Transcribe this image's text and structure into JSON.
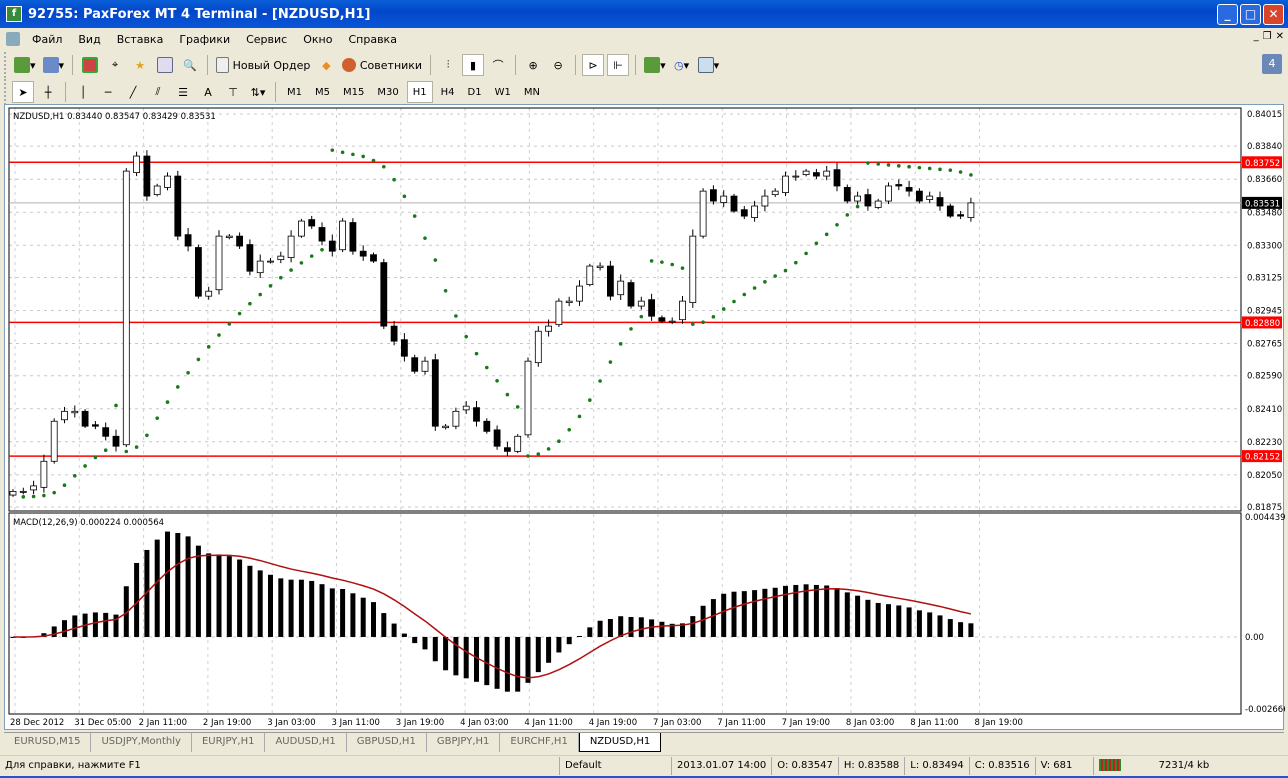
{
  "window": {
    "title": "92755: PaxForex MT 4 Terminal - [NZDUSD,H1]"
  },
  "menu": [
    "Файл",
    "Вид",
    "Вставка",
    "Графики",
    "Сервис",
    "Окно",
    "Справка"
  ],
  "toolbar": {
    "new_order": "Новый Ордер",
    "experts": "Советники"
  },
  "drawing_tools": {
    "text": "A"
  },
  "timeframes": [
    "M1",
    "M5",
    "M15",
    "M30",
    "H1",
    "H4",
    "D1",
    "W1",
    "MN"
  ],
  "active_timeframe": "H1",
  "chart": {
    "info": "NZDUSD,H1  0.83440 0.83547 0.83429 0.83531",
    "macd_info": "MACD(12,26,9) 0.000224 0.000564",
    "price_ticks": [
      "0.84015",
      "0.83840",
      "0.83660",
      "0.83480",
      "0.83300",
      "0.83125",
      "0.82945",
      "0.82765",
      "0.82590",
      "0.82410",
      "0.82230",
      "0.82050",
      "0.81875"
    ],
    "price_range": [
      0.81875,
      0.84015
    ],
    "macd_ticks": [
      "0.004439",
      "0.00",
      "-0.002666"
    ],
    "macd_range": [
      -0.002666,
      0.004439
    ],
    "hlines": [
      {
        "price": 0.83752,
        "label": "0.83752"
      },
      {
        "price": 0.8288,
        "label": "0.82880"
      },
      {
        "price": 0.82152,
        "label": "0.82152"
      }
    ],
    "current_price": {
      "price": 0.83531,
      "label": "0.83531"
    },
    "time_labels": [
      "28 Dec 2012",
      "31 Dec 05:00",
      "2 Jan 11:00",
      "2 Jan 19:00",
      "3 Jan 03:00",
      "3 Jan 11:00",
      "3 Jan 19:00",
      "4 Jan 03:00",
      "4 Jan 11:00",
      "4 Jan 19:00",
      "7 Jan 03:00",
      "7 Jan 11:00",
      "7 Jan 19:00",
      "8 Jan 03:00",
      "8 Jan 11:00",
      "8 Jan 19:00"
    ],
    "colors": {
      "bull": "#ffffff",
      "bear": "#000000",
      "sar": "#1a7a1a",
      "hline": "#ff0000",
      "macd_signal": "#b01010"
    }
  },
  "chart_data": {
    "type": "candlestick",
    "title": "NZDUSD,H1",
    "closes": [
      0.8196,
      0.8196,
      0.8199,
      0.82124,
      0.82342,
      0.82396,
      0.82396,
      0.82315,
      0.82315,
      0.8226,
      0.82206,
      0.83704,
      0.83786,
      0.83568,
      0.83623,
      0.83677,
      0.8335,
      0.83296,
      0.83023,
      0.8305,
      0.8335,
      0.8335,
      0.83296,
      0.83159,
      0.83214,
      0.83214,
      0.83241,
      0.8335,
      0.83432,
      0.83405,
      0.83323,
      0.83268,
      0.83432,
      0.83268,
      0.83241,
      0.83214,
      0.8286,
      0.82778,
      0.82696,
      0.82614,
      0.82669,
      0.82315,
      0.82315,
      0.82396,
      0.82424,
      0.82342,
      0.82287,
      0.82206,
      0.82178,
      0.8226,
      0.82669,
      0.82832,
      0.8286,
      0.82996,
      0.82996,
      0.83078,
      0.83187,
      0.83187,
      0.83023,
      0.83105,
      0.82969,
      0.82996,
      0.82914,
      0.82887,
      0.82887,
      0.82996,
      0.8335,
      0.83595,
      0.83541,
      0.83568,
      0.83486,
      0.83459,
      0.83514,
      0.83568,
      0.83595,
      0.83677,
      0.83677,
      0.83704,
      0.83677,
      0.83704,
      0.83623,
      0.83541,
      0.83568,
      0.83514,
      0.83541,
      0.83623,
      0.83623,
      0.83595,
      0.83541,
      0.83568,
      0.83514,
      0.83459,
      0.83459,
      0.83531
    ]
  },
  "tabs": [
    "EURUSD,M15",
    "USDJPY,Monthly",
    "EURJPY,H1",
    "AUDUSD,H1",
    "GBPUSD,H1",
    "GBPJPY,H1",
    "EURCHF,H1",
    "NZDUSD,H1"
  ],
  "active_tab": "NZDUSD,H1",
  "status": {
    "help": "Для справки, нажмите F1",
    "profile": "Default",
    "time": "2013.01.07 14:00",
    "open": "O: 0.83547",
    "high": "H: 0.83588",
    "low": "L: 0.83494",
    "close": "C: 0.83516",
    "volume": "V: 681",
    "traffic": "7231/4 kb"
  }
}
